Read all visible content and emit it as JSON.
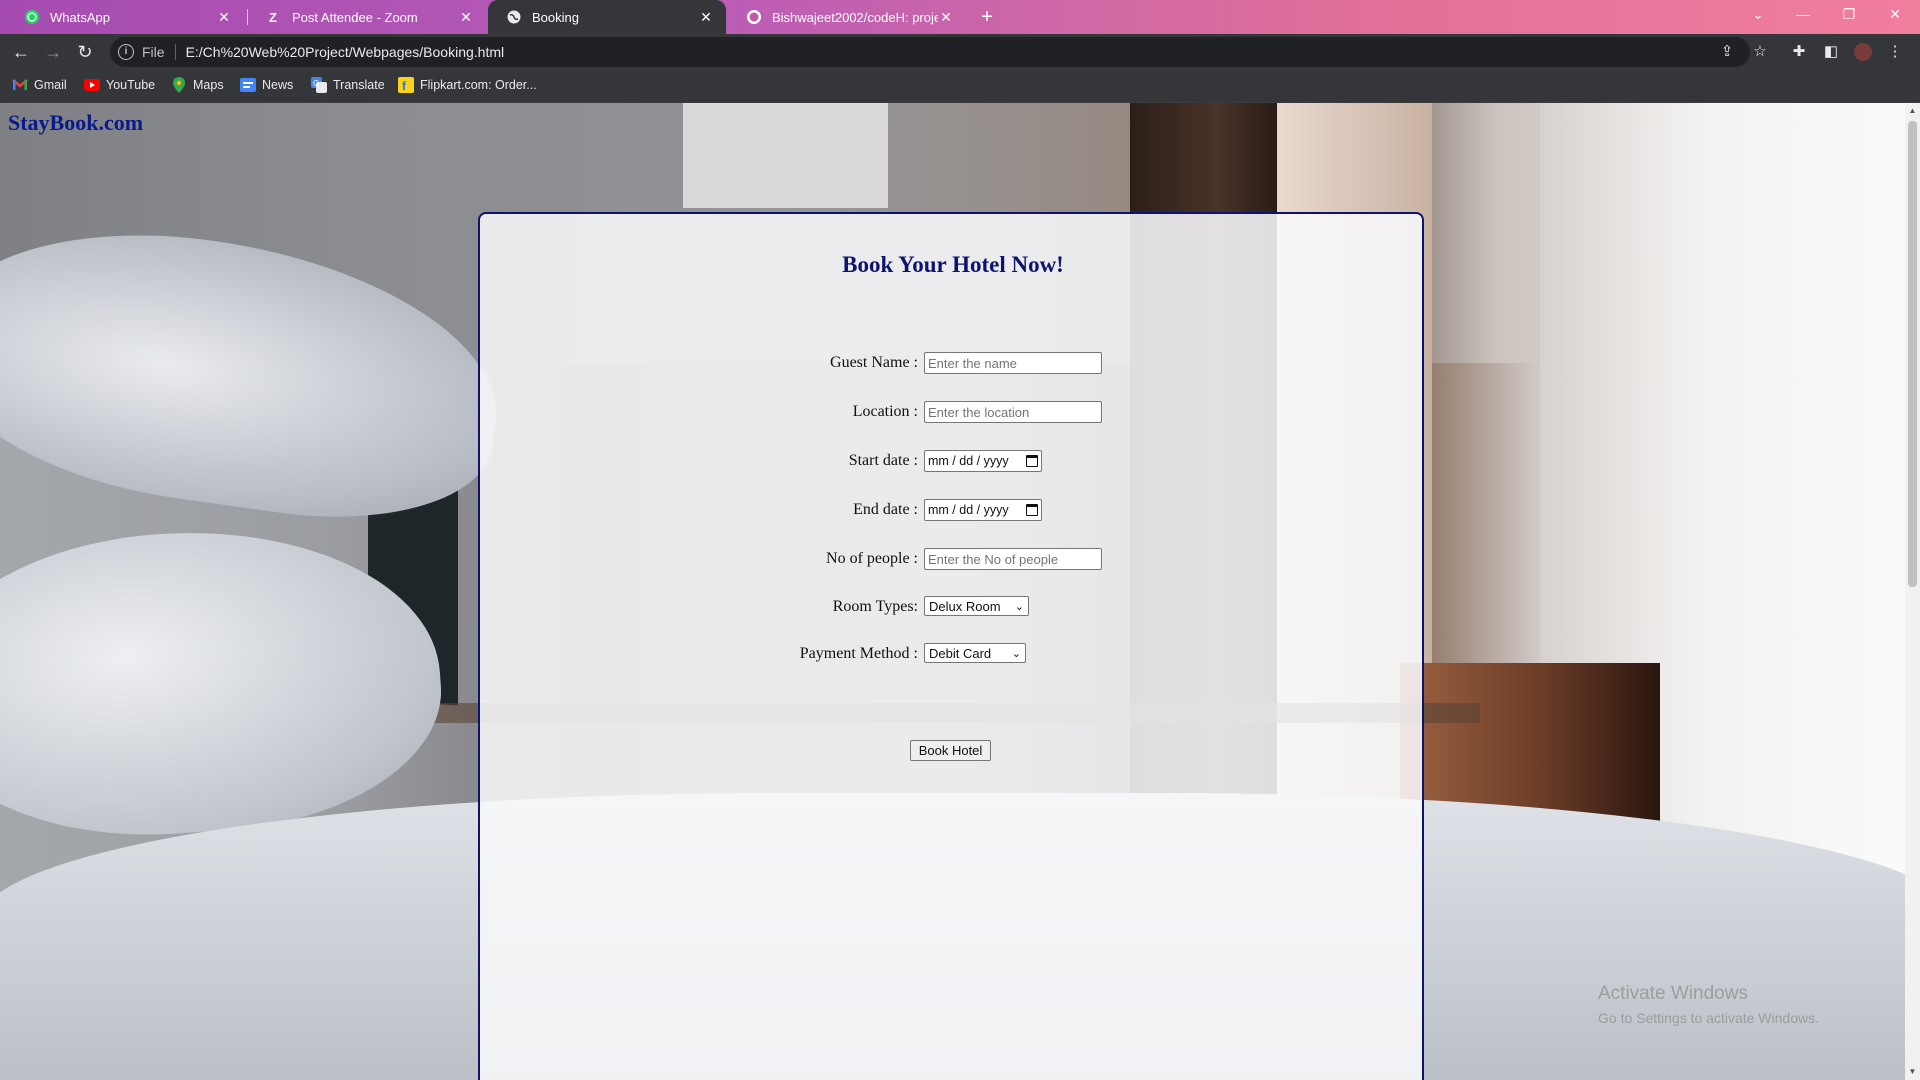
{
  "browser": {
    "tabs": [
      {
        "title": "WhatsApp",
        "icon": "whatsapp-icon",
        "active": false
      },
      {
        "title": "Post Attendee - Zoom",
        "icon": "zoom-icon",
        "active": false
      },
      {
        "title": "Booking",
        "icon": "globe-icon",
        "active": true
      },
      {
        "title": "Bishwajeet2002/codeH: project",
        "icon": "github-icon",
        "active": false
      }
    ],
    "address": {
      "scheme_label": "File",
      "url": "E:/Ch%20Web%20Project/Webpages/Booking.html"
    },
    "bookmarks": [
      {
        "label": "Gmail",
        "icon": "gmail-icon"
      },
      {
        "label": "YouTube",
        "icon": "youtube-icon"
      },
      {
        "label": "Maps",
        "icon": "maps-icon"
      },
      {
        "label": "News",
        "icon": "news-icon"
      },
      {
        "label": "Translate",
        "icon": "translate-icon"
      },
      {
        "label": "Flipkart.com: Order...",
        "icon": "flipkart-icon"
      }
    ]
  },
  "page": {
    "brand": "StayBook.com",
    "heading": "Book Your Hotel Now!",
    "form": {
      "guest_name": {
        "label": "Guest Name :",
        "placeholder": "Enter the name"
      },
      "location": {
        "label": "Location :",
        "placeholder": "Enter the location"
      },
      "start_date": {
        "label": "Start date :",
        "value": "mm / dd / yyyy"
      },
      "end_date": {
        "label": "End date :",
        "value": "mm / dd / yyyy"
      },
      "people": {
        "label": "No of people :",
        "placeholder": "Enter the No of people"
      },
      "room_type": {
        "label": "Room Types:",
        "selected": "Delux Room"
      },
      "payment": {
        "label": "Payment Method :",
        "selected": "Debit Card"
      },
      "submit_label": "Book Hotel"
    },
    "watermark": {
      "title": "Activate Windows",
      "subtitle": "Go to Settings to activate Windows."
    }
  },
  "colors": {
    "brand": "#0a1a8c",
    "panel_border": "#0d1470",
    "tab_active": "#35363a"
  }
}
